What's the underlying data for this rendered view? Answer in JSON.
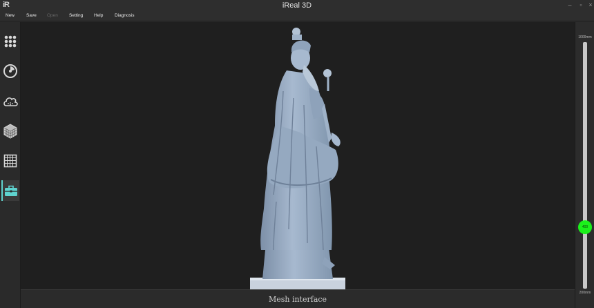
{
  "app": {
    "logo": "iR",
    "title": "iReal 3D",
    "window_controls": {
      "minimize": "–",
      "maximize": "▫",
      "close": "×"
    }
  },
  "menu": [
    {
      "label": "New",
      "enabled": true
    },
    {
      "label": "Save",
      "enabled": true
    },
    {
      "label": "Open",
      "enabled": false
    },
    {
      "label": "Setting",
      "enabled": true
    },
    {
      "label": "Help",
      "enabled": true
    },
    {
      "label": "Diagnosis",
      "enabled": true
    }
  ],
  "toolbar": [
    {
      "icon": "grid-dots-icon",
      "active": false
    },
    {
      "icon": "scan-dial-icon",
      "active": false
    },
    {
      "icon": "point-cloud-icon",
      "active": false
    },
    {
      "icon": "mesh-cube-icon",
      "active": false
    },
    {
      "icon": "grid-icon",
      "active": false
    },
    {
      "icon": "toolbox-icon",
      "active": true
    }
  ],
  "viewport": {
    "content": "3d-mesh-model-statue",
    "model_color": "#9aaec4",
    "background": "#1f1f1f"
  },
  "status": {
    "text": "Mesh interface"
  },
  "depth_slider": {
    "max_label": "1000mm",
    "min_label": "200mm",
    "value_label": "400",
    "value": 400,
    "min": 200,
    "max": 1000,
    "knob_color": "#1bf01b"
  }
}
